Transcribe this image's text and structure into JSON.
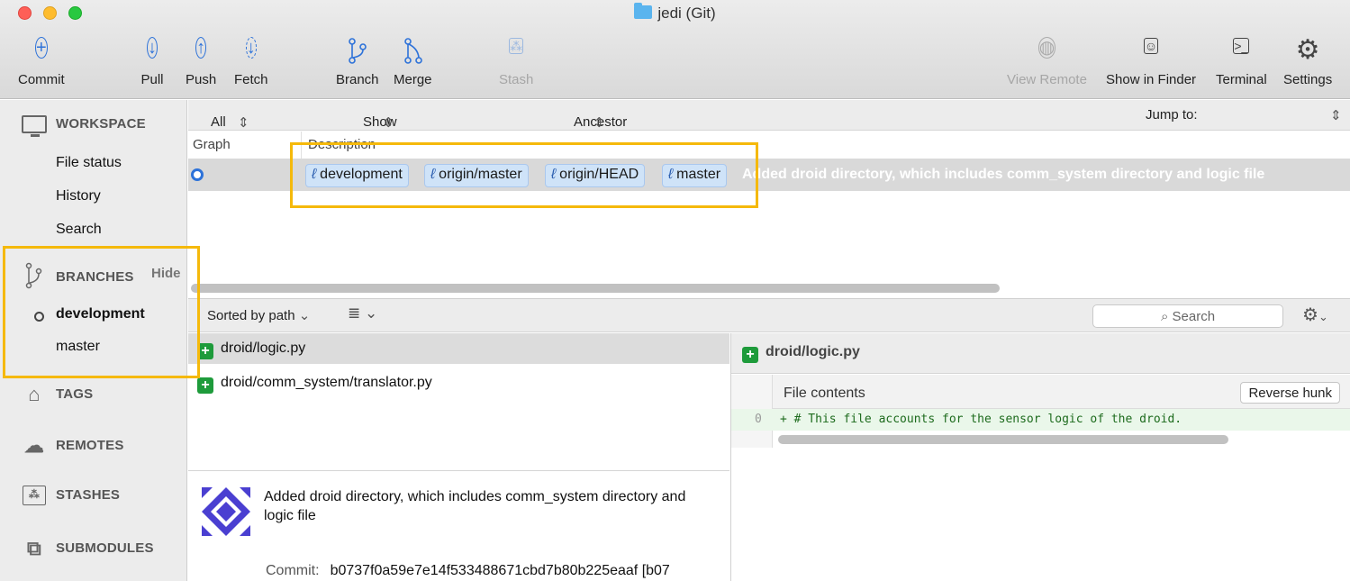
{
  "window": {
    "title": "jedi (Git)"
  },
  "toolbar": {
    "commit": "Commit",
    "pull": "Pull",
    "push": "Push",
    "fetch": "Fetch",
    "branch": "Branch",
    "merge": "Merge",
    "stash": "Stash",
    "view_remote": "View Remote",
    "show_in_finder": "Show in Finder",
    "terminal": "Terminal",
    "settings": "Settings"
  },
  "sidebar": {
    "workspace": "WORKSPACE",
    "workspace_items": [
      "File status",
      "History",
      "Search"
    ],
    "branches": "BRANCHES",
    "branches_hide": "Hide",
    "branch_items": [
      "development",
      "master"
    ],
    "tags": "TAGS",
    "remotes": "REMOTES",
    "stashes": "STASHES",
    "submodules": "SUBMODULES"
  },
  "filters": {
    "branches": "All Branches",
    "remote": "Show Remote Branches",
    "order": "Ancestor Order",
    "jump": "Jump to:"
  },
  "history": {
    "col_graph": "Graph",
    "col_description": "Description",
    "tags": [
      "development",
      "origin/master",
      "origin/HEAD",
      "master"
    ],
    "message": "Added droid directory, which includes comm_system directory and logic file"
  },
  "files": {
    "sort": "Sorted by path",
    "search_placeholder": "Search",
    "items": [
      "droid/logic.py",
      "droid/comm_system/translator.py"
    ]
  },
  "commit": {
    "message": "Added droid directory, which includes comm_system directory and logic file",
    "hash_label": "Commit:",
    "hash": "b0737f0a59e7e14f533488671cbd7b80b225eaaf [b07"
  },
  "diff": {
    "file": "droid/logic.py",
    "hunk": "File contents",
    "reverse": "Reverse hunk",
    "line_no": "0",
    "line": "+ # This file accounts for the sensor logic of the droid."
  },
  "colors": {
    "accent": "#2d72d9",
    "highlight": "#f5b90b",
    "added": "#1e9b3b"
  }
}
